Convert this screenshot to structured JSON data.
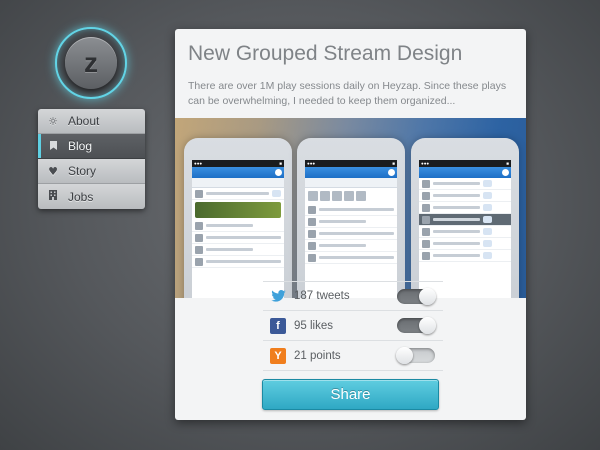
{
  "logo": {
    "letter": "z"
  },
  "nav": {
    "items": [
      {
        "label": "About",
        "icon": "gear-icon",
        "active": false
      },
      {
        "label": "Blog",
        "icon": "bookmark-icon",
        "active": true
      },
      {
        "label": "Story",
        "icon": "heart-icon",
        "active": false
      },
      {
        "label": "Jobs",
        "icon": "building-icon",
        "active": false
      }
    ]
  },
  "post": {
    "title": "New Grouped Stream Design",
    "description": "There are over 1M play sessions daily on Heyzap. Since these plays can be overwhelming, I needed to keep them organized..."
  },
  "social": {
    "twitter": {
      "label": "187 tweets",
      "icon": "twitter-icon",
      "enabled": true
    },
    "facebook": {
      "label": "95 likes",
      "icon": "facebook-icon",
      "enabled": true
    },
    "hackernews": {
      "label": "21 points",
      "icon": "y-icon",
      "enabled": false
    }
  },
  "share_label": "Share",
  "colors": {
    "accent": "#5fd0e3",
    "share_button": "#2fa8c4",
    "twitter": "#3fa1da",
    "facebook": "#3b5998",
    "hackernews": "#f07e1d"
  }
}
